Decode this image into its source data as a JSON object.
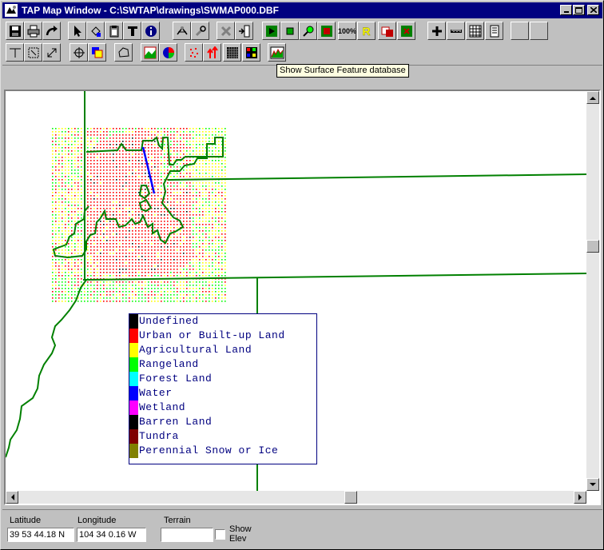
{
  "window": {
    "title": "TAP Map Window - C:\\SWTAP\\drawings\\SWMAP000.DBF"
  },
  "toolbar": {
    "tooltip": "Show Surface Feature database",
    "zoom_label": "100%",
    "r_label": "R"
  },
  "legend": {
    "items": [
      {
        "label": "Undefined",
        "color": "#000000"
      },
      {
        "label": "Urban or Built-up Land",
        "color": "#ff0000"
      },
      {
        "label": "Agricultural Land",
        "color": "#ffff00"
      },
      {
        "label": "Rangeland",
        "color": "#00ff00"
      },
      {
        "label": "Forest Land",
        "color": "#00ffff"
      },
      {
        "label": "Water",
        "color": "#0000ff"
      },
      {
        "label": "Wetland",
        "color": "#ff00ff"
      },
      {
        "label": "Barren Land",
        "color": "#000000"
      },
      {
        "label": "Tundra",
        "color": "#800000"
      },
      {
        "label": "Perennial Snow or Ice",
        "color": "#808000"
      }
    ]
  },
  "status": {
    "latitude_label": "Latitude",
    "latitude_value": "39 53 44.18 N",
    "longitude_label": "Longitude",
    "longitude_value": "104 34 0.16 W",
    "terrain_label": "Terrain",
    "terrain_value": "",
    "show_elev_label_1": "Show",
    "show_elev_label_2": "Elev",
    "show_elev_checked": false
  },
  "map": {
    "boundary_color": "#008000",
    "water_color": "#0000ff"
  }
}
